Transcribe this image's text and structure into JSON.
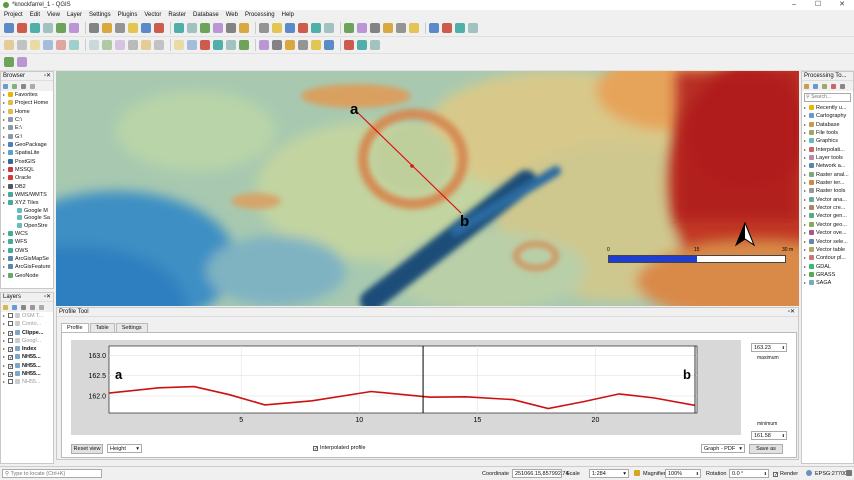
{
  "window": {
    "title": "*knockfarrel_1 - QGIS",
    "controls": [
      "–",
      "☐",
      "✕"
    ]
  },
  "menu": [
    "Project",
    "Edit",
    "View",
    "Layer",
    "Settings",
    "Plugins",
    "Vector",
    "Raster",
    "Database",
    "Web",
    "Processing",
    "Help"
  ],
  "browser": {
    "title": "Browser",
    "items": [
      {
        "label": "Favorites",
        "level": 0,
        "icon": "star-icon"
      },
      {
        "label": "Project Home",
        "level": 0,
        "icon": "folder-icon"
      },
      {
        "label": "Home",
        "level": 0,
        "icon": "folder-icon"
      },
      {
        "label": "C:\\",
        "level": 0,
        "icon": "drive-icon"
      },
      {
        "label": "E:\\",
        "level": 0,
        "icon": "drive-icon"
      },
      {
        "label": "G:\\",
        "level": 0,
        "icon": "drive-icon"
      },
      {
        "label": "GeoPackage",
        "level": 0,
        "icon": "geopackage-icon"
      },
      {
        "label": "SpatiaLite",
        "level": 0,
        "icon": "spatialite-icon"
      },
      {
        "label": "PostGIS",
        "level": 0,
        "icon": "postgis-icon"
      },
      {
        "label": "MSSQL",
        "level": 0,
        "icon": "mssql-icon"
      },
      {
        "label": "Oracle",
        "level": 0,
        "icon": "oracle-icon"
      },
      {
        "label": "DB2",
        "level": 0,
        "icon": "db2-icon"
      },
      {
        "label": "WMS/WMTS",
        "level": 0,
        "icon": "wms-icon"
      },
      {
        "label": "XYZ Tiles",
        "level": 0,
        "icon": "xyz-icon"
      },
      {
        "label": "Google M",
        "level": 1,
        "icon": "tile-icon"
      },
      {
        "label": "Google Sa",
        "level": 1,
        "icon": "tile-icon"
      },
      {
        "label": "OpenStre",
        "level": 1,
        "icon": "tile-icon"
      },
      {
        "label": "WCS",
        "level": 0,
        "icon": "wcs-icon"
      },
      {
        "label": "WFS",
        "level": 0,
        "icon": "wfs-icon"
      },
      {
        "label": "OWS",
        "level": 0,
        "icon": "ows-icon"
      },
      {
        "label": "ArcGisMapSe",
        "level": 0,
        "icon": "arcgis-icon"
      },
      {
        "label": "ArcGisFeature",
        "level": 0,
        "icon": "arcgis-icon"
      },
      {
        "label": "GeoNode",
        "level": 0,
        "icon": "geonode-icon"
      }
    ]
  },
  "layers": {
    "title": "Layers",
    "items": [
      {
        "label": "OSM T...",
        "checked": false,
        "bold": false,
        "grey": true
      },
      {
        "label": "Conto...",
        "checked": false,
        "bold": false,
        "grey": true
      },
      {
        "label": "Clippe...",
        "checked": true,
        "bold": true,
        "grey": false
      },
      {
        "label": "Googl...",
        "checked": false,
        "bold": false,
        "grey": true
      },
      {
        "label": "Index",
        "checked": true,
        "bold": true,
        "grey": false
      },
      {
        "label": "NH55...",
        "checked": true,
        "bold": true,
        "grey": false
      },
      {
        "label": "NH55...",
        "checked": true,
        "bold": true,
        "grey": false
      },
      {
        "label": "NH55...",
        "checked": true,
        "bold": true,
        "grey": false
      },
      {
        "label": "NH55...",
        "checked": false,
        "bold": false,
        "grey": true
      }
    ]
  },
  "processing": {
    "title": "Processing To...",
    "search_placeholder": "Search...",
    "items": [
      "Recently u...",
      "Cartography",
      "Database",
      "File tools",
      "Graphics",
      "Interpolati...",
      "Layer tools",
      "Network a...",
      "Raster anal...",
      "Raster ter...",
      "Raster tools",
      "Vector ana...",
      "Vector cre...",
      "Vector gen...",
      "Vector geo...",
      "Vector ove...",
      "Vector sele...",
      "Vector table",
      "Contour pl...",
      "GDAL",
      "GRASS",
      "SAGA"
    ]
  },
  "map": {
    "label_a": "a",
    "label_b": "b",
    "scalebar": {
      "labels": [
        "0",
        "15",
        "30 m"
      ]
    },
    "north_arrow": "north-arrow-icon"
  },
  "profile_tool": {
    "title": "Profile Tool",
    "tabs": [
      "Profile",
      "Table",
      "Settings"
    ],
    "active_tab": "Profile",
    "maximum_value": "163.23",
    "maximum_label": "maximum",
    "minimum_value": "161.58",
    "minimum_label": "minimum",
    "reset_view_label": "Reset view",
    "height_option": "Height",
    "interpolated_label": "Interpolated profile",
    "interpolated_checked": true,
    "graph_option": "Graph - PDF",
    "save_label": "Save as"
  },
  "status": {
    "locate_placeholder": "Type to locate (Ctrl+K)",
    "coordinate_label": "Coordinate",
    "coordinate_value": "251066.15,857992.74",
    "scale_label": "Scale",
    "scale_value": "1:284",
    "magnifier_label": "Magnifier",
    "magnifier_value": "100%",
    "rotation_label": "Rotation",
    "rotation_value": "0.0 °",
    "render_label": "Render",
    "crs_label": "EPSG:27700"
  },
  "chart_data": {
    "type": "line",
    "title": "",
    "xlabel": "",
    "ylabel": "",
    "xlim": [
      -0.6,
      24.3
    ],
    "ylim": [
      161.58,
      163.23
    ],
    "xticks": [
      5,
      10,
      15,
      20
    ],
    "yticks": [
      162.0,
      162.5,
      163.0
    ],
    "ytick_labels": [
      "162.0",
      "162.5",
      "163.0"
    ],
    "grid": true,
    "legend": "none",
    "annotations": [
      {
        "text": "a",
        "side": "left"
      },
      {
        "text": "b",
        "side": "right"
      }
    ],
    "marker_x": 12.7,
    "series": [
      {
        "color": "#cc1111",
        "x": [
          -0.6,
          1.5,
          3.0,
          4.5,
          6.0,
          8.0,
          10.5,
          13.0,
          14.5,
          16.5,
          18.0,
          19.5,
          21.0,
          22.5,
          24.2
        ],
        "y": [
          162.07,
          162.2,
          162.23,
          162.03,
          161.78,
          161.88,
          162.11,
          161.97,
          161.98,
          161.91,
          161.69,
          161.86,
          162.05,
          161.95,
          161.77
        ]
      }
    ]
  }
}
